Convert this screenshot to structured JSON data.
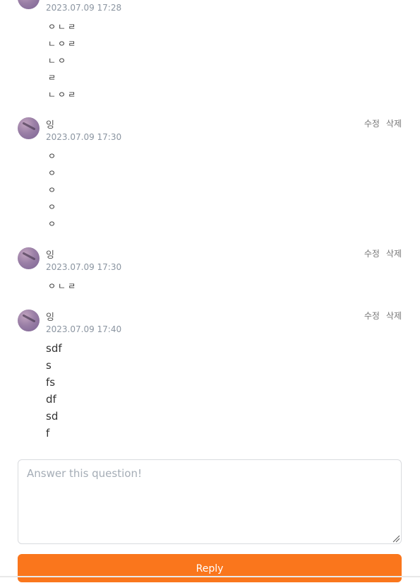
{
  "comments": [
    {
      "author": "",
      "time": "2023.07.09 17:28",
      "edit_label": "",
      "delete_label": "",
      "lines": [
        "ㅇㄴㄹ",
        "ㄴㅇㄹ",
        "ㄴㅇ",
        "ㄹ",
        "ㄴㅇㄹ"
      ]
    },
    {
      "author": "잉",
      "time": "2023.07.09 17:30",
      "edit_label": "수정",
      "delete_label": "삭제",
      "lines": [
        "ㅇ",
        "ㅇ",
        "ㅇ",
        "ㅇ",
        "ㅇ"
      ]
    },
    {
      "author": "잉",
      "time": "2023.07.09 17:30",
      "edit_label": "수정",
      "delete_label": "삭제",
      "lines": [
        "ㅇㄴㄹ"
      ]
    },
    {
      "author": "잉",
      "time": "2023.07.09 17:40",
      "edit_label": "수정",
      "delete_label": "삭제",
      "lines": [
        "sdf",
        "s",
        "fs",
        "df",
        "sd",
        "f"
      ]
    }
  ],
  "reply_form": {
    "placeholder": "Answer this question!",
    "value": "",
    "button_label": "Reply"
  },
  "colors": {
    "accent": "#fa761c",
    "timestamp": "#8b95a1",
    "placeholder": "#a5adb6"
  }
}
